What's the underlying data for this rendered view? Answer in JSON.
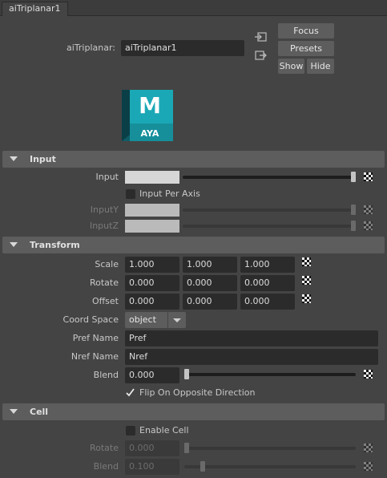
{
  "tab": {
    "label": "aiTriplanar1"
  },
  "header": {
    "node_label": "aiTriplanar:",
    "node_name": "aiTriplanar1",
    "buttons": {
      "focus": "Focus",
      "presets": "Presets",
      "show": "Show",
      "hide": "Hide"
    },
    "logo": {
      "letter": "M",
      "text": "AYA"
    }
  },
  "input_section": {
    "title": "Input",
    "input_label": "Input",
    "per_axis_label": "Input Per Axis",
    "input_y_label": "InputY",
    "input_z_label": "InputZ"
  },
  "transform_section": {
    "title": "Transform",
    "scale": {
      "label": "Scale",
      "x": "1.000",
      "y": "1.000",
      "z": "1.000"
    },
    "rotate": {
      "label": "Rotate",
      "x": "0.000",
      "y": "0.000",
      "z": "0.000"
    },
    "offset": {
      "label": "Offset",
      "x": "0.000",
      "y": "0.000",
      "z": "0.000"
    },
    "coord_space": {
      "label": "Coord Space",
      "value": "object"
    },
    "pref_name": {
      "label": "Pref Name",
      "value": "Pref"
    },
    "nref_name": {
      "label": "Nref Name",
      "value": "Nref"
    },
    "blend": {
      "label": "Blend",
      "value": "0.000"
    },
    "flip_label": "Flip On Opposite Direction",
    "flip_checked": true
  },
  "cell_section": {
    "title": "Cell",
    "enable_label": "Enable Cell",
    "rotate": {
      "label": "Rotate",
      "value": "0.000"
    },
    "blend": {
      "label": "Blend",
      "value": "0.100"
    }
  },
  "colors": {
    "background": "#444444",
    "section_header": "#5d5d5d",
    "field": "#2b2b2b",
    "logo_teal": "#1ba8b6"
  }
}
